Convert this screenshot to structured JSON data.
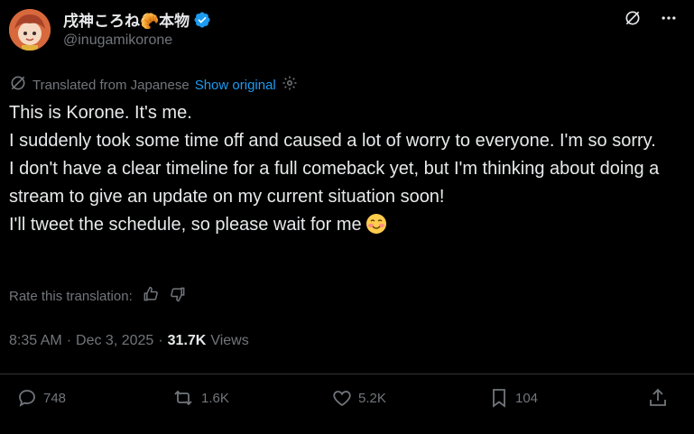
{
  "author": {
    "display_name": "戌神ころね🥐本物",
    "handle": "@inugamikorone",
    "avatar_icon": "avatar-image",
    "verified_icon": "verified-badge-icon"
  },
  "header_icons": [
    "grok-icon",
    "more-icon"
  ],
  "translation": {
    "label": "Translated from Japanese",
    "show_original": "Show original",
    "settings_icon": "gear-icon"
  },
  "tweet": {
    "lines": [
      "This is Korone. It's me.",
      "I suddenly took some time off and caused a lot of worry to everyone. I'm so sorry.",
      "I don't have a clear timeline for a full comeback yet, but I'm thinking about doing a stream to give an update on my current situation soon!",
      "I'll tweet the schedule, so please wait for me"
    ],
    "trailing_emoji": "smiling-blushing-face-emoji"
  },
  "rating": {
    "label": "Rate this translation:",
    "icons": [
      "thumbs-up-icon",
      "thumbs-down-icon"
    ]
  },
  "meta": {
    "time": "8:35 AM",
    "separator": "·",
    "date": "Dec 3, 2025",
    "views_count": "31.7K",
    "views_label": "Views"
  },
  "actions": {
    "replies": "748",
    "reposts": "1.6K",
    "likes": "5.2K",
    "bookmarks": "104"
  },
  "colors": {
    "background": "#000000",
    "text": "#e7e9ea",
    "muted": "#71767b",
    "link": "#1d9bf0",
    "divider": "#2f3336"
  }
}
